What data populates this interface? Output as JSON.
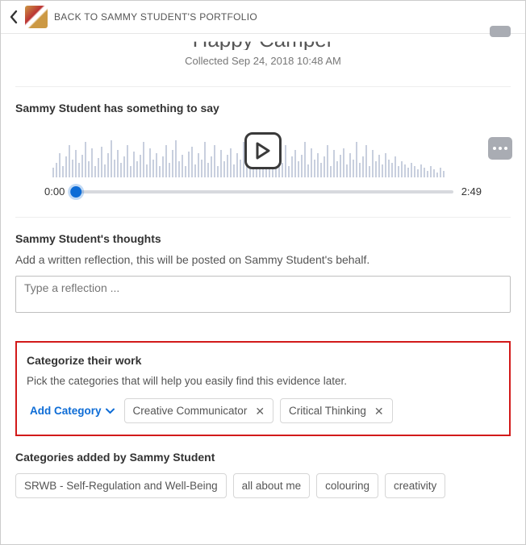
{
  "topbar": {
    "back_label": "BACK TO SAMMY STUDENT'S PORTFOLIO"
  },
  "header": {
    "title": "Happy Camper",
    "collected_prefix": "Collected",
    "collected_datetime": "Sep 24, 2018 10:48 AM"
  },
  "audio": {
    "heading": "Sammy Student has something to say",
    "start_time": "0:00",
    "end_time": "2:49"
  },
  "thoughts": {
    "heading": "Sammy Student's thoughts",
    "description": "Add a written reflection, this will be posted on Sammy Student's behalf.",
    "placeholder": "Type a reflection ..."
  },
  "categorize": {
    "heading": "Categorize their work",
    "description": "Pick the categories that will help you easily find this evidence later.",
    "add_label": "Add Category",
    "chips": [
      "Creative Communicator",
      "Critical Thinking"
    ]
  },
  "student_categories": {
    "heading": "Categories added by Sammy Student",
    "chips": [
      "SRWB - Self-Regulation and Well-Being",
      "all about me",
      "colouring",
      "creativity"
    ]
  }
}
